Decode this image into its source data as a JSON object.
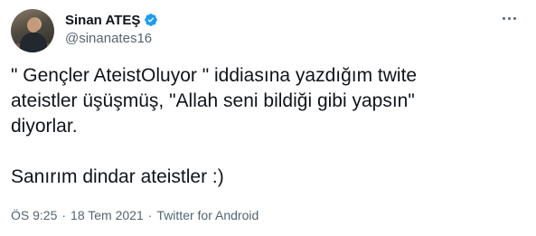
{
  "author": {
    "display_name": "Sinan ATEŞ",
    "handle": "@sinanates16",
    "verified": true
  },
  "tweet": {
    "lines_paragraph1": [
      "\" Gençler AteistOluyor \" iddiasına yazdığım twite",
      "ateistler üşüşmüş, \"Allah seni bildiği gibi yapsın\"",
      "diyorlar."
    ],
    "paragraph2": "Sanırım dindar ateistler :)"
  },
  "meta": {
    "time": "ÖS 9:25",
    "date": "18 Tem 2021",
    "source": "Twitter for Android",
    "separator": "·"
  },
  "colors": {
    "verified_badge": "#1d9bf0",
    "secondary_text": "#536471",
    "primary_text": "#0f1419"
  },
  "icons": {
    "verified": "verified-badge-icon",
    "more": "more-options-icon"
  }
}
